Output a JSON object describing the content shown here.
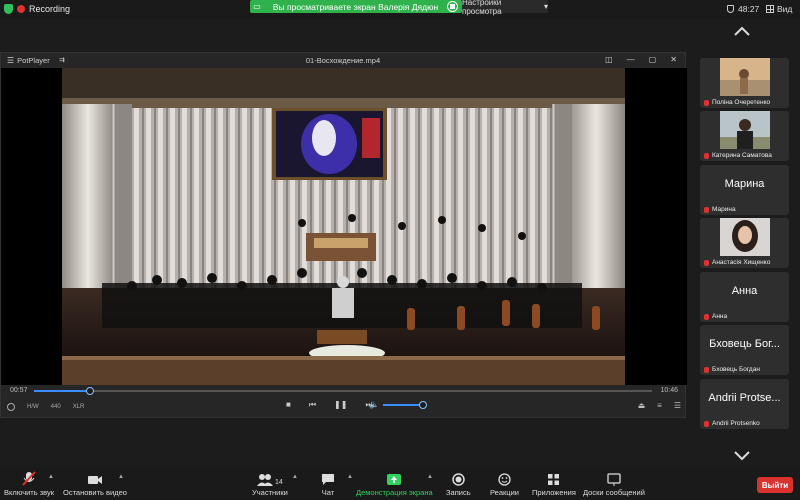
{
  "topbar": {
    "recording_label": "Recording",
    "share_banner": "Вы просматриваете экран Валерія Дядюн",
    "view_settings_label": "Настройки просмотра",
    "meeting_timer": "48:27",
    "view_label": "Вид"
  },
  "player": {
    "app_name": "PotPlayer",
    "file_name": "01-Восхождение.mp4",
    "current_time": "00:57",
    "total_time": "10:46",
    "progress": 0.09,
    "volume": 1.0,
    "left_tags": [
      "H/W",
      "440",
      "XLR"
    ]
  },
  "participants": [
    {
      "name": "Поліна Очеретенко",
      "display": "photo",
      "muted": true
    },
    {
      "name": "Катерина Саматова",
      "display": "photo",
      "muted": true
    },
    {
      "name": "Марина",
      "display": "Марина",
      "muted": true
    },
    {
      "name": "Анастасія Хищенко",
      "display": "photo",
      "muted": true
    },
    {
      "name": "Анна",
      "display": "Анна",
      "muted": true
    },
    {
      "name": "Бховець Богдан",
      "display": "Бховець Бог...",
      "muted": true
    },
    {
      "name": "Andrii Protsenko",
      "display": "Andrii Protse...",
      "muted": true
    }
  ],
  "toolbar": {
    "unmute": "Включить звук",
    "video": "Остановить видео",
    "participants": "Участники",
    "participants_count": "14",
    "chat": "Чат",
    "share": "Демонстрация экрана",
    "record": "Запись",
    "reactions": "Реакции",
    "apps": "Приложения",
    "whiteboards": "Доски сообщений",
    "leave": "Выйти"
  },
  "colors": {
    "accent_green": "#2fb24c",
    "leave_red": "#d9322d",
    "progress_blue": "#3b8cff"
  }
}
